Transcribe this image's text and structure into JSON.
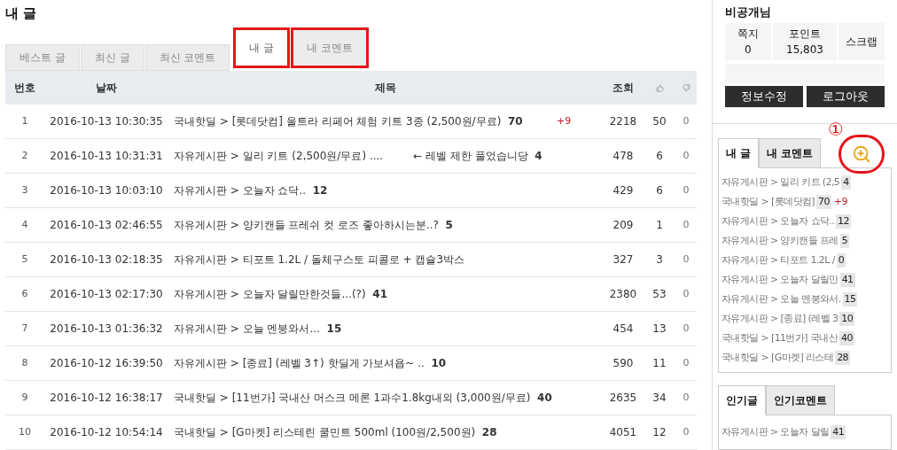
{
  "page_title": "내 글",
  "tabs": [
    {
      "label": "베스트 글",
      "selected": false,
      "annotated": false
    },
    {
      "label": "최신 글",
      "selected": false,
      "annotated": false
    },
    {
      "label": "최신 코멘트",
      "selected": false,
      "annotated": false
    },
    {
      "label": "내 글",
      "selected": true,
      "annotated": true
    },
    {
      "label": "내 코멘트",
      "selected": false,
      "annotated": true
    }
  ],
  "table": {
    "columns": [
      {
        "kind": "text",
        "label": "번호"
      },
      {
        "kind": "text",
        "label": "날짜"
      },
      {
        "kind": "text",
        "label": "제목"
      },
      {
        "kind": "text",
        "label": "조회"
      },
      {
        "kind": "like"
      },
      {
        "kind": "dislike"
      }
    ],
    "rows": [
      {
        "number": "1",
        "date": "2016-10-13 10:30:35",
        "title": "국내핫딜 > [롯데닷컴] 울트라 리페어 체험 키트 3종 (2,500원/무료)  **70**",
        "comment_delta": "+9",
        "views": "2218",
        "likes": "50",
        "dislikes": "0"
      },
      {
        "number": "2",
        "date": "2016-10-13 10:31:31",
        "title": "자유게시판 > 일리 키트 (2,500원/무료) ....",
        "note": "← 레벨 제한 풀었습니당  **4**",
        "views": "478",
        "likes": "6",
        "dislikes": "0"
      },
      {
        "number": "3",
        "date": "2016-10-13 10:03:10",
        "title": "자유게시판 > 오늘자 쇼닥..  **12**",
        "views": "429",
        "likes": "6",
        "dislikes": "0"
      },
      {
        "number": "4",
        "date": "2016-10-13 02:46:55",
        "title": "자유게시판 > 양키캔들 프레쉬 컷 로즈 좋아하시는분..?  **5**",
        "views": "209",
        "likes": "1",
        "dislikes": "0"
      },
      {
        "number": "5",
        "date": "2016-10-13 02:18:35",
        "title": "자유게시판 > 티포트 1.2L / 돌체구스토 피콜로 + 캡슐3박스",
        "views": "327",
        "likes": "3",
        "dislikes": "0"
      },
      {
        "number": "6",
        "date": "2016-10-13 02:17:30",
        "title": "자유게시판 > 오늘자 달릴만한것들...(?)  **41**",
        "views": "2380",
        "likes": "53",
        "dislikes": "0"
      },
      {
        "number": "7",
        "date": "2016-10-13 01:36:32",
        "title": "자유게시판 > 오늘 멘붕와서...  **15**",
        "views": "454",
        "likes": "13",
        "dislikes": "0"
      },
      {
        "number": "8",
        "date": "2016-10-12 16:39:50",
        "title": "자유게시판 > [종료] (레벨 3↑) 핫딜게 가보셔욥~ ..  **10**",
        "views": "590",
        "likes": "11",
        "dislikes": "0"
      },
      {
        "number": "9",
        "date": "2016-10-12 16:38:17",
        "title": "국내핫딜 > [11번가] 국내산 머스크 메론 1과수1.8kg내외 (3,000원/무료)  **40**",
        "views": "2635",
        "likes": "34",
        "dislikes": "0"
      },
      {
        "number": "10",
        "date": "2016-10-12 10:54:14",
        "title": "국내핫딜 > [G마켓] 리스테린 쿨민트 500ml (100원/2,500원)  **28**",
        "views": "4051",
        "likes": "12",
        "dislikes": "0"
      }
    ]
  },
  "sidebar": {
    "user_name": "비공개님",
    "stats": [
      {
        "label": "쪽지",
        "value": "0"
      },
      {
        "label": "포인트",
        "value": "15,803"
      },
      {
        "label": "스크랩"
      }
    ],
    "buttons": [
      "정보수정",
      "로그아웃"
    ],
    "marker": "①",
    "search_annotated": true,
    "my_tabs": [
      {
        "label": "내 글",
        "selected": true
      },
      {
        "label": "내 코멘트",
        "selected": false
      }
    ],
    "my_items": [
      {
        "title": "자유게시판 > 일리 키트 (2,5",
        "count": "4"
      },
      {
        "title": "국내핫딜 > [롯데닷컴]",
        "count": "70",
        "delta": "+9"
      },
      {
        "title": "자유게시판 > 오늘자 쇼닥..",
        "count": "12"
      },
      {
        "title": "자유게시판 > 양키캔들 프레",
        "count": "5"
      },
      {
        "title": "자유게시판 > 티포트 1.2L /",
        "count": "0"
      },
      {
        "title": "자유게시판 > 오늘자 달릴만",
        "count": "41"
      },
      {
        "title": "자유게시판 > 오늘 멘붕와서.",
        "count": "15"
      },
      {
        "title": "자유게시판 > [종료] (레벨 3",
        "count": "10"
      },
      {
        "title": "국내핫딜 > [11번가] 국내산",
        "count": "40"
      },
      {
        "title": "국내핫딜 > [G마켓] 리스테",
        "count": "28"
      }
    ],
    "popular_tabs": [
      {
        "label": "인기글",
        "selected": true
      },
      {
        "label": "인기코멘트",
        "selected": false
      }
    ],
    "popular_items": [
      {
        "title": "자유게시판 > 오늘자 달릴",
        "count": "41"
      }
    ]
  }
}
